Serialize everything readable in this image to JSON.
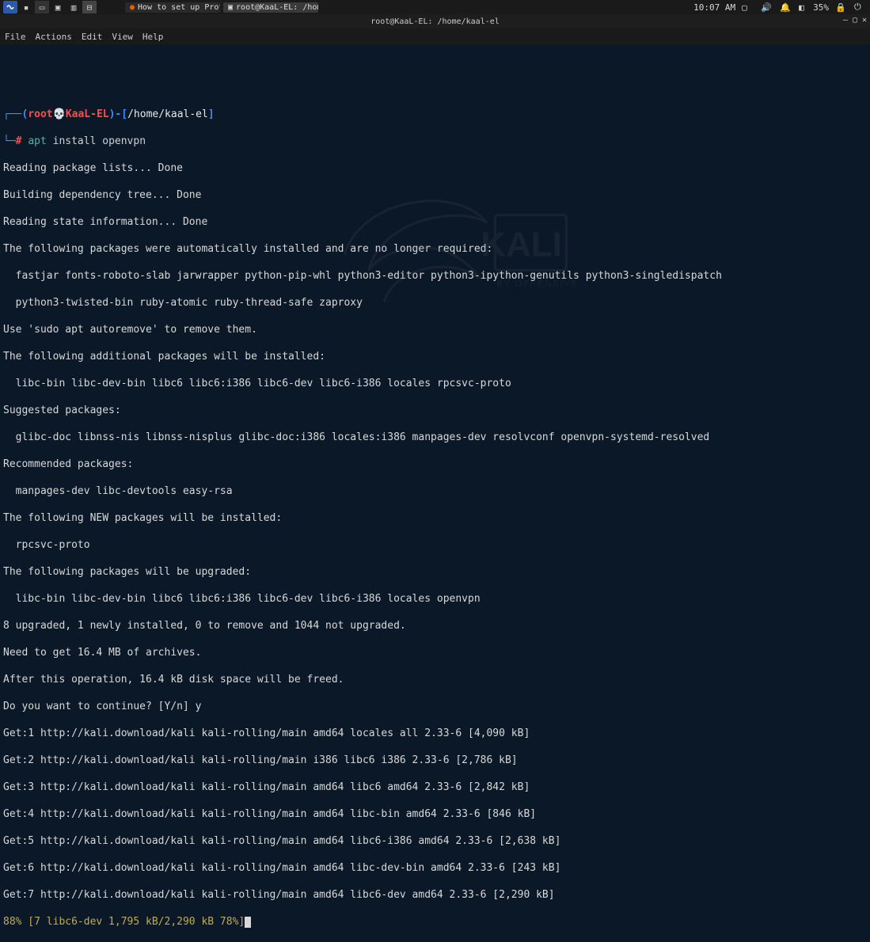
{
  "panel": {
    "taskbar": {
      "browser": "How to set up ProtonVP…",
      "terminal": "root@KaaL-EL: /home/k…"
    },
    "tray": {
      "time": "10:07 AM",
      "battery": "35%"
    }
  },
  "window": {
    "title": "root@KaaL-EL: /home/kaal-el"
  },
  "menu": {
    "file": "File",
    "actions": "Actions",
    "edit": "Edit",
    "view": "View",
    "help": "Help"
  },
  "prompt": {
    "lparen": "(",
    "user": "root",
    "host": "KaaL-EL",
    "rparen_bracket": ")-[",
    "cwd": "/home/kaal-el",
    "rbracket": "]",
    "hash": "#",
    "cmd_bin": "apt",
    "cmd_args": "install openvpn"
  },
  "out": {
    "l1": "Reading package lists... Done",
    "l2": "Building dependency tree... Done",
    "l3": "Reading state information... Done",
    "l4": "The following packages were automatically installed and are no longer required:",
    "l5": "  fastjar fonts-roboto-slab jarwrapper python-pip-whl python3-editor python3-ipython-genutils python3-singledispatch",
    "l6": "  python3-twisted-bin ruby-atomic ruby-thread-safe zaproxy",
    "l7": "Use 'sudo apt autoremove' to remove them.",
    "l8": "The following additional packages will be installed:",
    "l9": "  libc-bin libc-dev-bin libc6 libc6:i386 libc6-dev libc6-i386 locales rpcsvc-proto",
    "l10": "Suggested packages:",
    "l11": "  glibc-doc libnss-nis libnss-nisplus glibc-doc:i386 locales:i386 manpages-dev resolvconf openvpn-systemd-resolved",
    "l12": "Recommended packages:",
    "l13": "  manpages-dev libc-devtools easy-rsa",
    "l14": "The following NEW packages will be installed:",
    "l15": "  rpcsvc-proto",
    "l16": "The following packages will be upgraded:",
    "l17": "  libc-bin libc-dev-bin libc6 libc6:i386 libc6-dev libc6-i386 locales openvpn",
    "l18": "8 upgraded, 1 newly installed, 0 to remove and 1044 not upgraded.",
    "l19": "Need to get 16.4 MB of archives.",
    "l20": "After this operation, 16.4 kB disk space will be freed.",
    "l21": "Do you want to continue? [Y/n] y",
    "l22": "Get:1 http://kali.download/kali kali-rolling/main amd64 locales all 2.33-6 [4,090 kB]",
    "l23": "Get:2 http://kali.download/kali kali-rolling/main i386 libc6 i386 2.33-6 [2,786 kB]",
    "l24": "Get:3 http://kali.download/kali kali-rolling/main amd64 libc6 amd64 2.33-6 [2,842 kB]",
    "l25": "Get:4 http://kali.download/kali kali-rolling/main amd64 libc-bin amd64 2.33-6 [846 kB]",
    "l26": "Get:5 http://kali.download/kali kali-rolling/main amd64 libc6-i386 amd64 2.33-6 [2,638 kB]",
    "l27": "Get:6 http://kali.download/kali kali-rolling/main amd64 libc-dev-bin amd64 2.33-6 [243 kB]",
    "l28": "Get:7 http://kali.download/kali kali-rolling/main amd64 libc6-dev amd64 2.33-6 [2,290 kB]",
    "progress": "88% [7 libc6-dev 1,795 kB/2,290 kB 78%]"
  }
}
